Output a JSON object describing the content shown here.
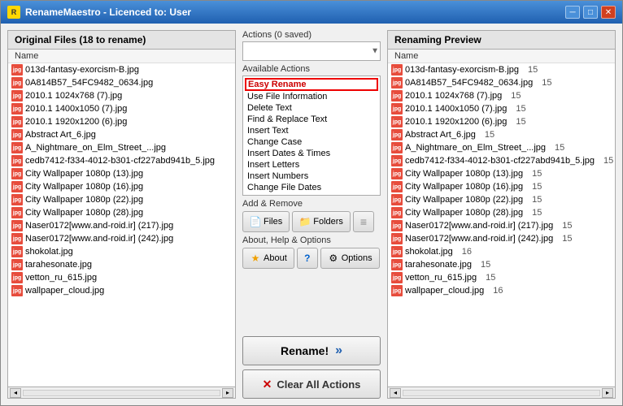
{
  "window": {
    "title": "RenameMaestro - Licenced to: User",
    "title_icon": "R"
  },
  "left_panel": {
    "header": "Original Files (18 to rename)",
    "subheader": "Name",
    "files": [
      "013d-fantasy-exorcism-B.jpg",
      "0A814B57_54FC9482_0634.jpg",
      "2010.1 1024x768 (7).jpg",
      "2010.1 1400x1050 (7).jpg",
      "2010.1 1920x1200 (6).jpg",
      "Abstract Art_6.jpg",
      "A_Nightmare_on_Elm_Street_...jpg",
      "cedb7412-f334-4012-b301-cf227abd941b_5.jpg",
      "City Wallpaper 1080p (13).jpg",
      "City Wallpaper 1080p (16).jpg",
      "City Wallpaper 1080p (22).jpg",
      "City Wallpaper 1080p (28).jpg",
      "Naser0172[www.and-roid.ir] (217).jpg",
      "Naser0172[www.and-roid.ir] (242).jpg",
      "shokolat.jpg",
      "tarahesonate.jpg",
      "vetton_ru_615.jpg",
      "wallpaper_cloud.jpg"
    ]
  },
  "middle": {
    "actions_label": "Actions (0 saved)",
    "actions_placeholder": "",
    "available_label": "Available Actions",
    "action_items": [
      {
        "label": "Easy Rename",
        "highlighted": true
      },
      {
        "label": "Use File Information",
        "highlighted": false
      },
      {
        "label": "Delete Text",
        "highlighted": false
      },
      {
        "label": "Find & Replace Text",
        "highlighted": false
      },
      {
        "label": "Insert Text",
        "highlighted": false
      },
      {
        "label": "Change Case",
        "highlighted": false
      },
      {
        "label": "Insert Dates & Times",
        "highlighted": false
      },
      {
        "label": "Insert Letters",
        "highlighted": false
      },
      {
        "label": "Insert Numbers",
        "highlighted": false
      },
      {
        "label": "Change File Dates",
        "highlighted": false
      }
    ],
    "add_remove_label": "Add & Remove",
    "files_btn": "Files",
    "folders_btn": "Folders",
    "about_help_label": "About, Help & Options",
    "about_btn": "About",
    "options_btn": "Options",
    "rename_btn": "Rename!",
    "clear_btn": "Clear All Actions"
  },
  "right_panel": {
    "header": "Renaming Preview",
    "subheader": "Name",
    "files": [
      {
        "name": "013d-fantasy-exorcism-B.jpg",
        "size": "15"
      },
      {
        "name": "0A814B57_54FC9482_0634.jpg",
        "size": "15"
      },
      {
        "name": "2010.1 1024x768 (7).jpg",
        "size": "15"
      },
      {
        "name": "2010.1 1400x1050 (7).jpg",
        "size": "15"
      },
      {
        "name": "2010.1 1920x1200 (6).jpg",
        "size": "15"
      },
      {
        "name": "Abstract Art_6.jpg",
        "size": "15"
      },
      {
        "name": "A_Nightmare_on_Elm_Street_...jpg",
        "size": "15"
      },
      {
        "name": "cedb7412-f334-4012-b301-cf227abd941b_5.jpg",
        "size": "15"
      },
      {
        "name": "City Wallpaper 1080p (13).jpg",
        "size": "15"
      },
      {
        "name": "City Wallpaper 1080p (16).jpg",
        "size": "15"
      },
      {
        "name": "City Wallpaper 1080p (22).jpg",
        "size": "15"
      },
      {
        "name": "City Wallpaper 1080p (28).jpg",
        "size": "15"
      },
      {
        "name": "Naser0172[www.and-roid.ir] (217).jpg",
        "size": "15"
      },
      {
        "name": "Naser0172[www.and-roid.ir] (242).jpg",
        "size": "15"
      },
      {
        "name": "shokolat.jpg",
        "size": "16"
      },
      {
        "name": "tarahesonate.jpg",
        "size": "15"
      },
      {
        "name": "vetton_ru_615.jpg",
        "size": "15"
      },
      {
        "name": "wallpaper_cloud.jpg",
        "size": "16"
      }
    ]
  }
}
